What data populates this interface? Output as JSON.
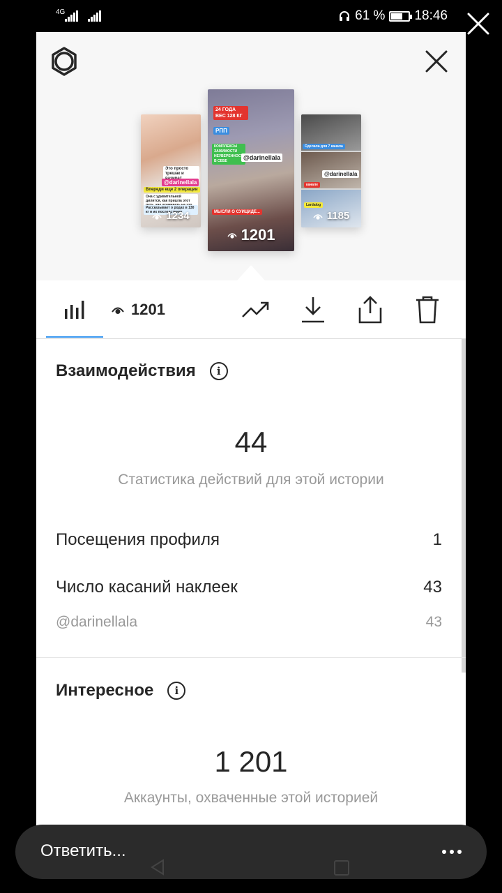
{
  "status_bar": {
    "signal1": "4G",
    "battery_percent": "61 %",
    "battery_level": 0.61,
    "time": "18:46"
  },
  "icons": {
    "gear": "gear-icon",
    "close": "close-icon",
    "bar_chart": "bar-chart-icon",
    "eye": "eye-icon",
    "trend": "trend-up-icon",
    "download": "download-icon",
    "share": "share-icon",
    "trash": "trash-icon",
    "info": "info-icon",
    "more": "more-icon"
  },
  "stories": [
    {
      "views": "1234",
      "tags": [
        "Это просто трешак и вазират",
        "@darinellala",
        "Впереди еще 2 операции",
        "Она с удивительной дилится, как пришла этот путь, как ухаживать на это",
        "Рассказывает о родах в 130 кг и их последствиях"
      ]
    },
    {
      "views": "1201",
      "tags": [
        "24 ГОДА ВЕС 128 КГ",
        "РПП",
        "КОМПЛЕКСЫ ЗАЖИМОСТИ НЕУВЕРЕННОСТИ В СЕБЕ",
        "@darinellala",
        "МЫСЛИ О СУИЦИДЕ..."
      ]
    },
    {
      "views": "1185",
      "tags": [
        "Сделала для 7 канала",
        "@darinellala",
        "канале",
        "Lardalog"
      ]
    }
  ],
  "toolbar": {
    "views_count": "1201"
  },
  "interactions": {
    "title": "Взаимодействия",
    "info_glyph": "i",
    "total": "44",
    "caption": "Статистика действий для этой истории",
    "rows": [
      {
        "label": "Посещения профиля",
        "value": "1"
      },
      {
        "label": "Число касаний наклеек",
        "value": "43"
      }
    ],
    "sub_row": {
      "label": "@darinellala",
      "value": "43"
    }
  },
  "discovery": {
    "title": "Интересное",
    "info_glyph": "i",
    "total": "1 201",
    "caption": "Аккаунты, охваченные этой историей"
  },
  "reply": {
    "placeholder": "Ответить..."
  }
}
